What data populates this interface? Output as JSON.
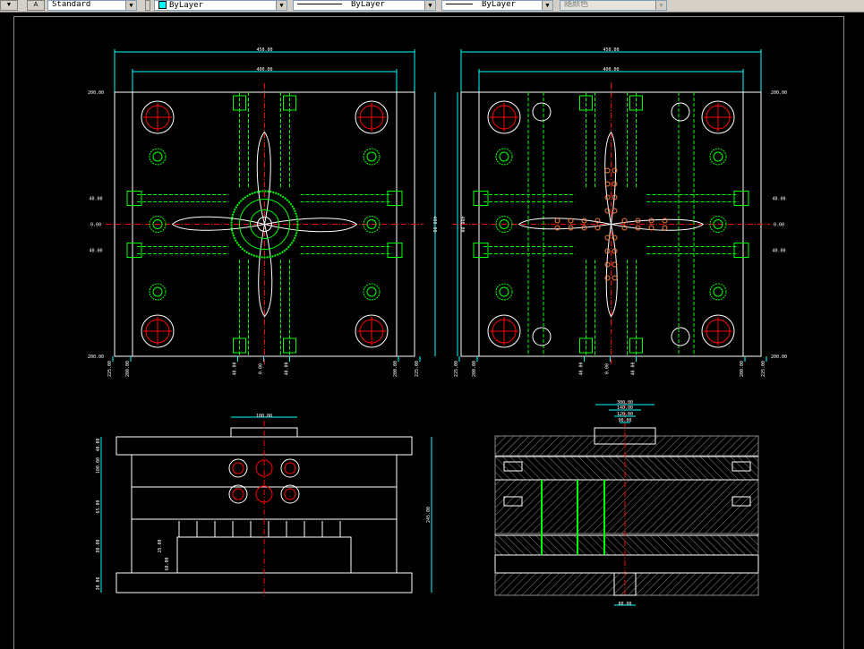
{
  "toolbar": {
    "text_style": "Standard",
    "layer_color": "ByLayer",
    "linetype": "ByLayer",
    "lineweight": "ByLayer",
    "plot_style": "随颜色"
  },
  "dims": {
    "top_left": {
      "overall_width": "450.00",
      "inner_width": "400.00",
      "y_top": "200.00",
      "y_bottom": "200.00",
      "y_p40": "40.00",
      "y_zero": "0.00",
      "y_m40": "40.00",
      "height": "400.00",
      "x_m225": "225.00",
      "x_m200": "200.00",
      "x_m40": "40.00",
      "x_zero": "0.00",
      "x_p40": "40.00",
      "x_p200": "200.00",
      "x_p225": "225.00"
    },
    "top_right": {
      "overall_width": "450.00",
      "inner_width": "400.00",
      "y_top": "200.00",
      "y_bottom": "200.00",
      "y_p40": "40.00",
      "y_zero": "0.00",
      "y_m40": "40.00",
      "height": "400.00",
      "x_m225": "225.00",
      "x_m200": "200.00",
      "x_m40": "40.00",
      "x_zero": "0.00",
      "x_p40": "40.00",
      "x_p200": "200.00",
      "x_p225": "225.00"
    },
    "bottom_left": {
      "top_width": "100.00",
      "h1": "40.00",
      "h2": "100.00",
      "h3": "65.00",
      "h4": "80.00",
      "h5": "30.00",
      "h6": "25.00",
      "h7": "60.00",
      "total": "245.00"
    },
    "bottom_right": {
      "d1": "300.00",
      "d2": "140.00",
      "d3": "120.00",
      "d4": "90.00",
      "bottom": "80.00"
    }
  },
  "colors": {
    "outline": "#ffffff",
    "dimension": "#00ffff",
    "center": "#ff0000",
    "parts": "#00ff00",
    "hatch": "#8a8a8a",
    "dots": "#ff8040"
  }
}
